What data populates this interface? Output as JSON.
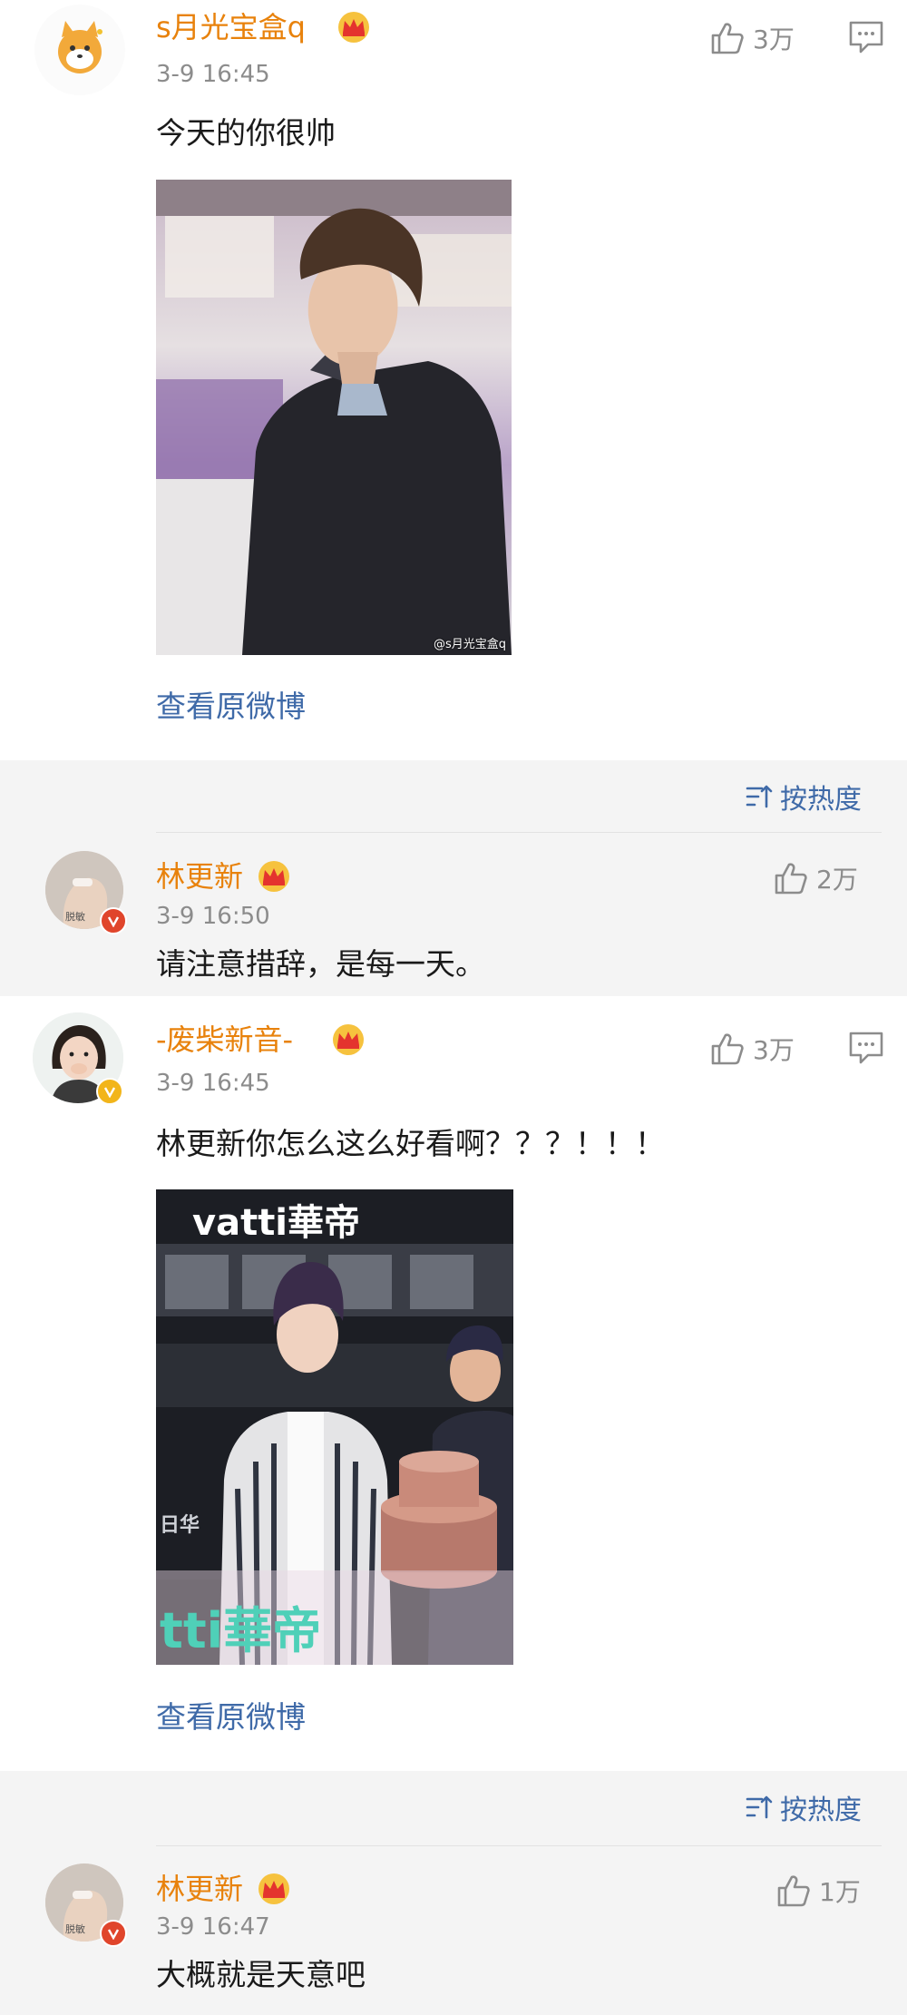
{
  "colors": {
    "username": "#e8820c",
    "link": "#3f6aa8",
    "meta_grey": "#8c8c8c",
    "panel_bg": "#f4f4f4"
  },
  "post1": {
    "username": "s月光宝盒q",
    "timestamp": "3-9 16:45",
    "likes": "3万",
    "text": "今天的你很帅",
    "photo_watermark": "@s月光宝盒q",
    "view_original": "查看原微博"
  },
  "reply1": {
    "sort_label": "按热度",
    "username": "林更新",
    "timestamp": "3-9 16:50",
    "likes": "2万",
    "text": "请注意措辞，是每一天。"
  },
  "post2": {
    "username": "-废柴新音-",
    "timestamp": "3-9 16:45",
    "likes": "3万",
    "text": "林更新你怎么这么好看啊？？？！！！",
    "photo_brand_top": "vatti華帝",
    "photo_brand_bottom": "tti華帝",
    "photo_side_text": "日华",
    "view_original": "查看原微博"
  },
  "reply2": {
    "sort_label": "按热度",
    "username": "林更新",
    "timestamp": "3-9 16:47",
    "likes": "1万",
    "text": "大概就是天意吧"
  },
  "icons": {
    "like": "thumbs-up-icon",
    "comment": "comment-icon",
    "crown": "crown-icon",
    "sort": "sort-icon",
    "verified": "verified-v-icon"
  }
}
